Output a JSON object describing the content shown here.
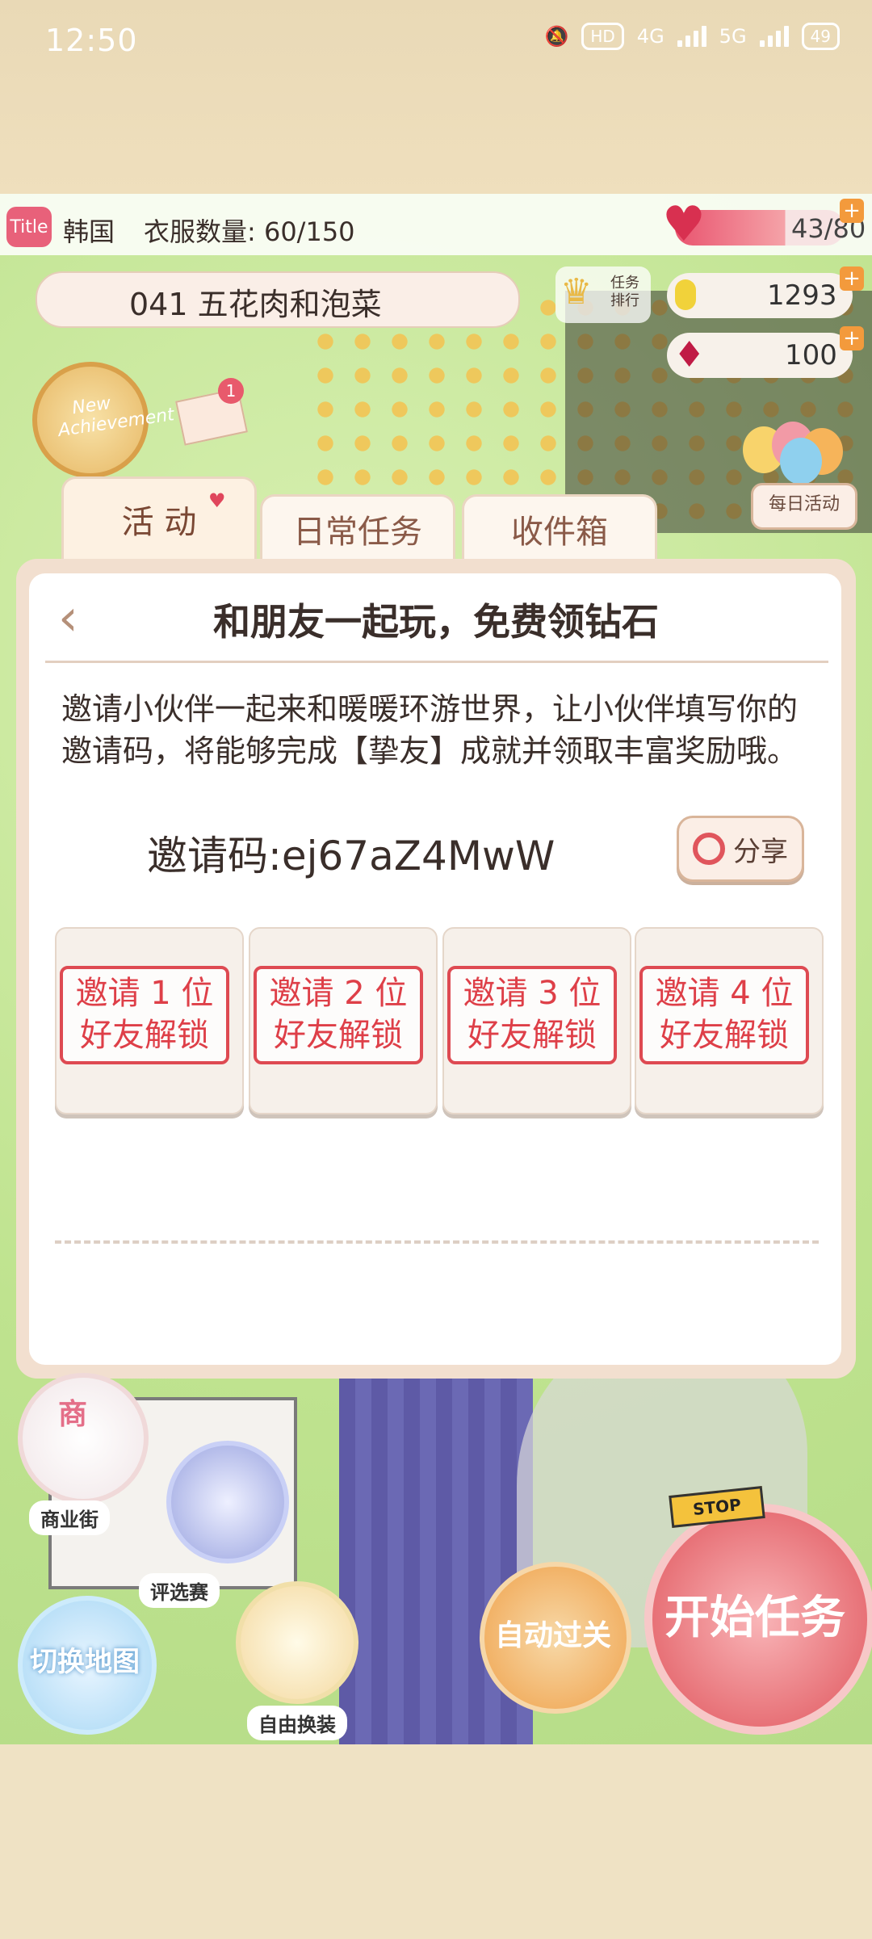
{
  "status": {
    "time": "12:50",
    "hd": "HD",
    "net1": "4G",
    "net2": "5G",
    "battery": "49"
  },
  "hud": {
    "title_badge": "Title",
    "region": "韩国",
    "clothes_count": "衣服数量: 60/150",
    "hp": "43/80",
    "stage": "041 五花肉和泡菜",
    "task_rank": "任务排行",
    "coins": "1293",
    "gems": "100",
    "plus": "+",
    "achievement_text": "New Achievement",
    "mail_badge": "1",
    "daily_activity": "每日活动"
  },
  "tabs": [
    {
      "label": "活 动"
    },
    {
      "label": "日常任务"
    },
    {
      "label": "收件箱"
    }
  ],
  "panel": {
    "back": "‹",
    "title": "和朋友一起玩，免费领钻石",
    "description": "邀请小伙伴一起来和暖暖环游世界，让小伙伴填写你的邀请码，将能够完成【挚友】成就并领取丰富奖励哦。",
    "invite_code": "邀请码:ej67aZ4MwW",
    "share_label": "分享",
    "slots": [
      {
        "line1": "邀请 1 位",
        "line2": "好友解锁"
      },
      {
        "line1": "邀请 2 位",
        "line2": "好友解锁"
      },
      {
        "line1": "邀请 3 位",
        "line2": "好友解锁"
      },
      {
        "line1": "邀请 4 位",
        "line2": "好友解锁"
      }
    ]
  },
  "bottom": {
    "shop_char": "商",
    "shop_label": "商业街",
    "contest_label": "评选赛",
    "map_label": "切换地图",
    "dressup_label": "自由换装",
    "auto_label": "自动过关",
    "start_label": "开始任务",
    "stop_sign": "STOP"
  },
  "colors": {
    "accent_red": "#de4a52",
    "panel_border": "#f2dfcf",
    "status_bg": "#efdfbd"
  }
}
